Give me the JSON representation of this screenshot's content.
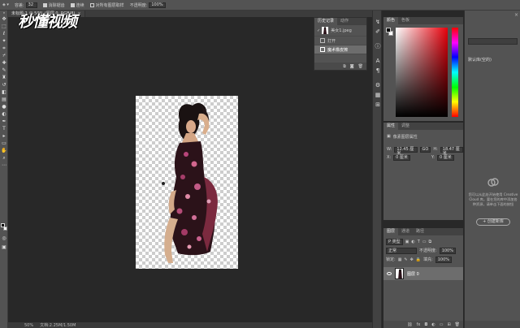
{
  "logo": {
    "text": "秒懂视频"
  },
  "options_bar": {
    "tolerance_label": "容差:",
    "tolerance_value": "32",
    "antialias_label": "消除锯齿",
    "contiguous_label": "连续",
    "sample_all_label": "对所有图层取样",
    "opacity_label": "不透明度:",
    "opacity_value": "100%"
  },
  "document_tab": {
    "label": "未标题-1 @ 50% (图层 0, RGB/8)",
    "close": "×"
  },
  "status_bar": {
    "zoom": "50%",
    "doc_info": "文档:2.25M/1.50M"
  },
  "history_panel": {
    "tabs": [
      "历史记录",
      "动作"
    ],
    "snapshot_label": "美女1.jpeg",
    "steps": [
      "打开",
      "魔术橡皮擦"
    ]
  },
  "color_panel": {
    "tabs": [
      "颜色",
      "色板"
    ],
    "hue_color": "#e8000b"
  },
  "properties_panel": {
    "tabs": [
      "属性",
      "调整"
    ],
    "title": "像素图层属性",
    "w_label": "W:",
    "w_value": "12.45 厘米",
    "go_label": "GO",
    "h_label": "H:",
    "h_value": "18.47 厘米",
    "x_label": "X:",
    "x_value": "0 厘米",
    "y_label": "Y:",
    "y_value": "0 厘米"
  },
  "layers_panel": {
    "tabs": [
      "图层",
      "通道",
      "路径"
    ],
    "filter_label": "P 类型",
    "blend_mode": "正常",
    "opacity_label": "不透明度:",
    "opacity_value": "100%",
    "lock_label": "锁定:",
    "fill_label": "填充:",
    "fill_value": "100%",
    "layer_name": "图层 0"
  },
  "library_panel": {
    "title": "默认库(空的)",
    "empty_text": "您可以从此处开始使用 Creative Cloud 库。要在您的库中添加各种资源，请单击下面的按钮",
    "button_label": "创建新库"
  }
}
